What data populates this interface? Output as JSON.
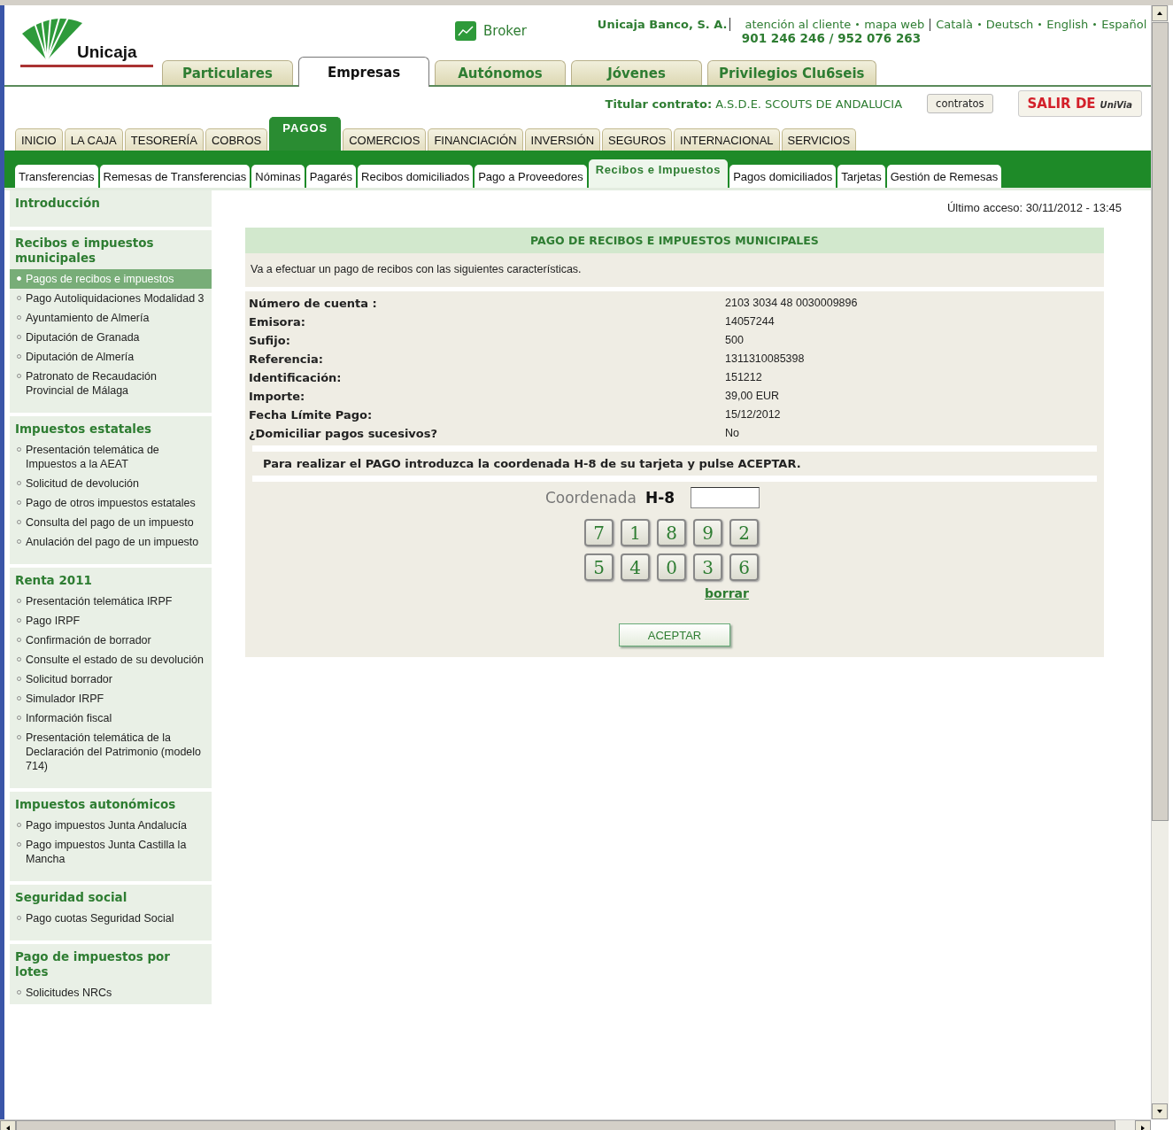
{
  "header": {
    "logo": "Unicaja",
    "broker": "Broker",
    "bank": "Unicaja Banco, S. A.",
    "links": [
      "atención al cliente",
      "mapa web"
    ],
    "phone": "901 246 246 / 952 076 263",
    "languages": [
      "Català",
      "Deutsch",
      "English",
      "Español"
    ]
  },
  "segment_tabs": [
    {
      "label": "Particulares",
      "selected": false
    },
    {
      "label": "Empresas",
      "selected": true
    },
    {
      "label": "Autónomos",
      "selected": false
    },
    {
      "label": "Jóvenes",
      "selected": false
    },
    {
      "label": "Privilegios Clu6seis",
      "selected": false
    }
  ],
  "contract": {
    "label": "Titular contrato:",
    "value": "A.S.D.E. SCOUTS DE ANDALUCIA",
    "contracts_button": "contratos",
    "logout": "SALIR DE",
    "logout_brand": "UniVia"
  },
  "main_tabs": [
    {
      "label": "INICIO",
      "selected": false
    },
    {
      "label": "LA CAJA",
      "selected": false
    },
    {
      "label": "TESORERÍA",
      "selected": false
    },
    {
      "label": "COBROS",
      "selected": false
    },
    {
      "label": "PAGOS",
      "selected": true
    },
    {
      "label": "COMERCIOS",
      "selected": false
    },
    {
      "label": "FINANCIACIÓN",
      "selected": false
    },
    {
      "label": "INVERSIÓN",
      "selected": false
    },
    {
      "label": "SEGUROS",
      "selected": false
    },
    {
      "label": "INTERNACIONAL",
      "selected": false
    },
    {
      "label": "SERVICIOS",
      "selected": false
    }
  ],
  "sub_tabs": [
    {
      "label": "Transferencias",
      "selected": false
    },
    {
      "label": "Remesas de Transferencias",
      "selected": false
    },
    {
      "label": "Nóminas",
      "selected": false
    },
    {
      "label": "Pagarés",
      "selected": false
    },
    {
      "label": "Recibos domiciliados",
      "selected": false
    },
    {
      "label": "Pago a Proveedores",
      "selected": false
    },
    {
      "label": "Recibos e Impuestos",
      "selected": true
    },
    {
      "label": "Pagos domiciliados",
      "selected": false
    },
    {
      "label": "Tarjetas",
      "selected": false
    },
    {
      "label": "Gestión de Remesas",
      "selected": false
    }
  ],
  "sidebar": [
    {
      "title": "Introducción"
    },
    {
      "title": "Recibos e impuestos municipales",
      "items": [
        {
          "label": "Pagos de recibos e impuestos",
          "selected": true
        },
        {
          "label": "Pago Autoliquidaciones Modalidad 3",
          "selected": false
        },
        {
          "label": "Ayuntamiento de Almería",
          "selected": false
        },
        {
          "label": "Diputación de Granada",
          "selected": false
        },
        {
          "label": "Diputación de Almería",
          "selected": false
        },
        {
          "label": "Patronato de Recaudación Provincial de Málaga",
          "selected": false
        }
      ]
    },
    {
      "title": "Impuestos estatales",
      "items": [
        {
          "label": "Presentación telemática de Impuestos a la AEAT",
          "selected": false
        },
        {
          "label": "Solicitud de devolución",
          "selected": false
        },
        {
          "label": "Pago de otros impuestos estatales",
          "selected": false
        },
        {
          "label": "Consulta del pago de un impuesto",
          "selected": false
        },
        {
          "label": "Anulación del pago de un impuesto",
          "selected": false
        }
      ]
    },
    {
      "title": "Renta 2011",
      "items": [
        {
          "label": "Presentación telemática IRPF",
          "selected": false
        },
        {
          "label": "Pago IRPF",
          "selected": false
        },
        {
          "label": "Confirmación de borrador",
          "selected": false
        },
        {
          "label": "Consulte el estado de su devolución",
          "selected": false
        },
        {
          "label": "Solicitud borrador",
          "selected": false
        },
        {
          "label": "Simulador IRPF",
          "selected": false
        },
        {
          "label": "Información fiscal",
          "selected": false
        },
        {
          "label": "Presentación telemática de la Declaración del Patrimonio (modelo 714)",
          "selected": false
        }
      ]
    },
    {
      "title": "Impuestos autonómicos",
      "items": [
        {
          "label": "Pago impuestos Junta Andalucía",
          "selected": false
        },
        {
          "label": "Pago impuestos Junta Castilla la Mancha",
          "selected": false
        }
      ]
    },
    {
      "title": "Seguridad social",
      "items": [
        {
          "label": "Pago cuotas Seguridad Social",
          "selected": false
        }
      ]
    },
    {
      "title": "Pago de impuestos por lotes",
      "items": [
        {
          "label": "Solicitudes NRCs",
          "selected": false
        }
      ]
    }
  ],
  "last_access": "Último acceso: 30/11/2012 - 13:45",
  "panel": {
    "title": "PAGO DE RECIBOS E IMPUESTOS MUNICIPALES",
    "intro": "Va a efectuar un pago de recibos con las siguientes características.",
    "fields": [
      {
        "label": "Número de cuenta :",
        "value": "2103 3034 48 0030009896"
      },
      {
        "label": "Emisora:",
        "value": "14057244"
      },
      {
        "label": "Sufijo:",
        "value": "500"
      },
      {
        "label": "Referencia:",
        "value": "1311310085398"
      },
      {
        "label": "Identificación:",
        "value": "151212"
      },
      {
        "label": "Importe:",
        "value": "39,00 EUR"
      },
      {
        "label": "Fecha Límite Pago:",
        "value": "15/12/2012"
      },
      {
        "label": "¿Domiciliar pagos sucesivos?",
        "value": "No"
      }
    ],
    "instruction": "Para realizar el PAGO introduzca la coordenada H-8 de su tarjeta y pulse ACEPTAR.",
    "coordinate_label": "Coordenada",
    "coordinate_code": "H-8",
    "keypad": [
      [
        "7",
        "1",
        "8",
        "9",
        "2"
      ],
      [
        "5",
        "4",
        "0",
        "3",
        "6"
      ]
    ],
    "clear": "borrar",
    "submit": "ACEPTAR"
  }
}
